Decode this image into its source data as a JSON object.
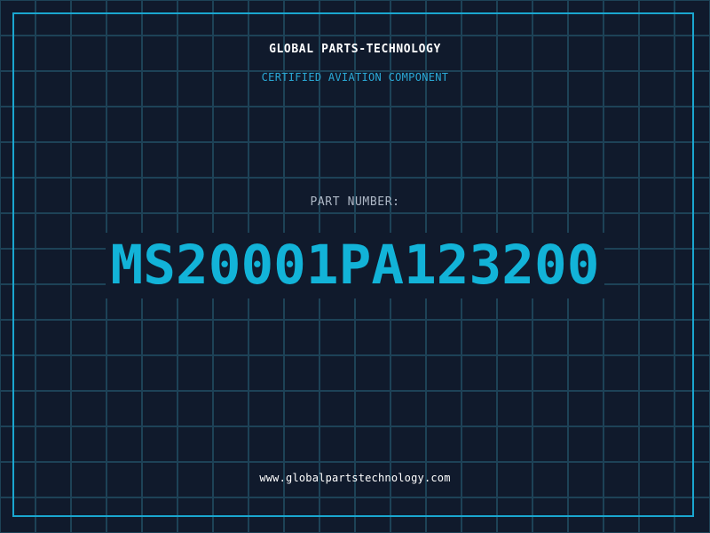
{
  "brand": "GLOBAL PARTS-TECHNOLOGY",
  "tagline": "CERTIFIED AVIATION COMPONENT",
  "part_label": "PART NUMBER:",
  "part_number": "MS20001PA123200",
  "website": "www.globalpartstechnology.com",
  "colors": {
    "background": "#101a2c",
    "grid": "#1d4257",
    "frame": "#1aa6cf",
    "accent": "#12b3d8",
    "label": "#aeb8c6",
    "brand_text": "#ffffff"
  }
}
